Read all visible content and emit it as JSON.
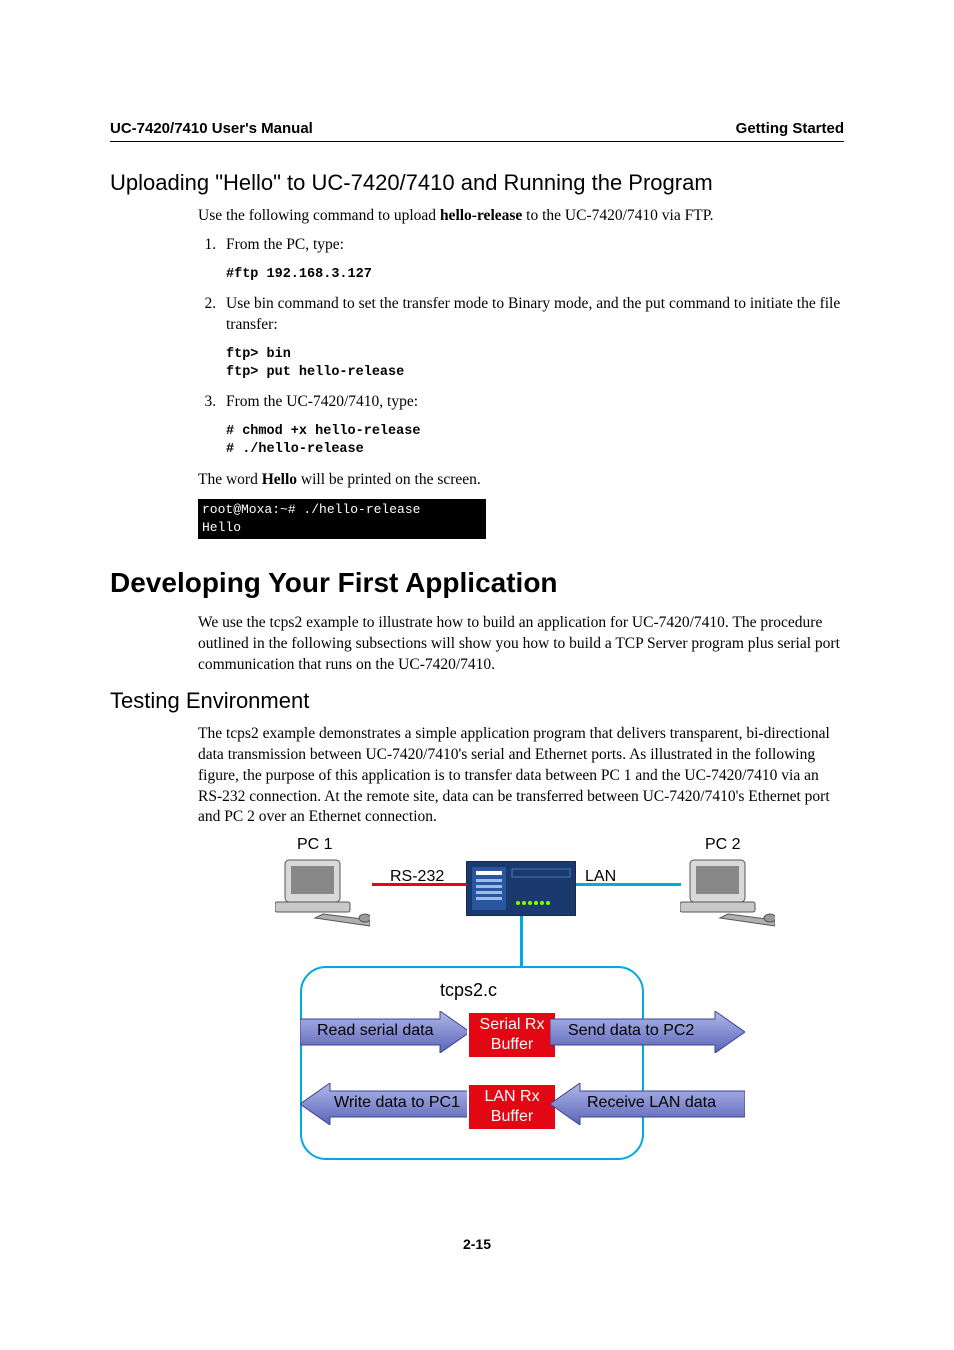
{
  "header": {
    "left": "UC-7420/7410 User's Manual",
    "right": "Getting Started"
  },
  "sec1": {
    "title": "Uploading \"Hello\" to UC-7420/7410 and Running the Program",
    "intro_pre": "Use the following command to upload ",
    "intro_bold": "hello-release",
    "intro_post": " to the UC-7420/7410 via FTP.",
    "li1": "From the PC, type:",
    "code1": "#ftp 192.168.3.127",
    "li2": "Use bin command to set the transfer mode to Binary mode, and the put command to initiate the file transfer:",
    "code2": "ftp> bin\nftp> put hello-release",
    "li3": "From the UC-7420/7410, type:",
    "code3": "# chmod +x hello-release\n# ./hello-release",
    "outro_pre": "The word ",
    "outro_bold": "Hello",
    "outro_post": " will be printed on the screen.",
    "terminal": "root@Moxa:~# ./hello-release\nHello"
  },
  "sec2": {
    "title": "Developing Your First Application",
    "para": "We use the tcps2 example to illustrate how to build an application for UC-7420/7410. The procedure outlined in the following subsections will show you how to build a TCP Server program plus serial port communication that runs on the UC-7420/7410."
  },
  "sec3": {
    "title": "Testing Environment",
    "para": "The tcps2 example demonstrates a simple application program that delivers transparent, bi-directional data transmission between UC-7420/7410's serial and Ethernet ports. As illustrated in the following figure, the purpose of this application is to transfer data between PC 1 and the UC-7420/7410 via an RS-232 connection. At the remote site, data can be transferred between UC-7420/7410's Ethernet port and PC 2 over an Ethernet connection."
  },
  "diagram": {
    "pc1": "PC 1",
    "pc2": "PC 2",
    "rs232": "RS-232",
    "lan": "LAN",
    "title": "tcps2.c",
    "read": "Read serial data",
    "srx": "Serial Rx\nBuffer",
    "send": "Send data to PC2",
    "write": "Write data to PC1",
    "lrx": "LAN Rx\nBuffer",
    "recv": "Receive LAN data"
  },
  "pagenum": "2-15"
}
